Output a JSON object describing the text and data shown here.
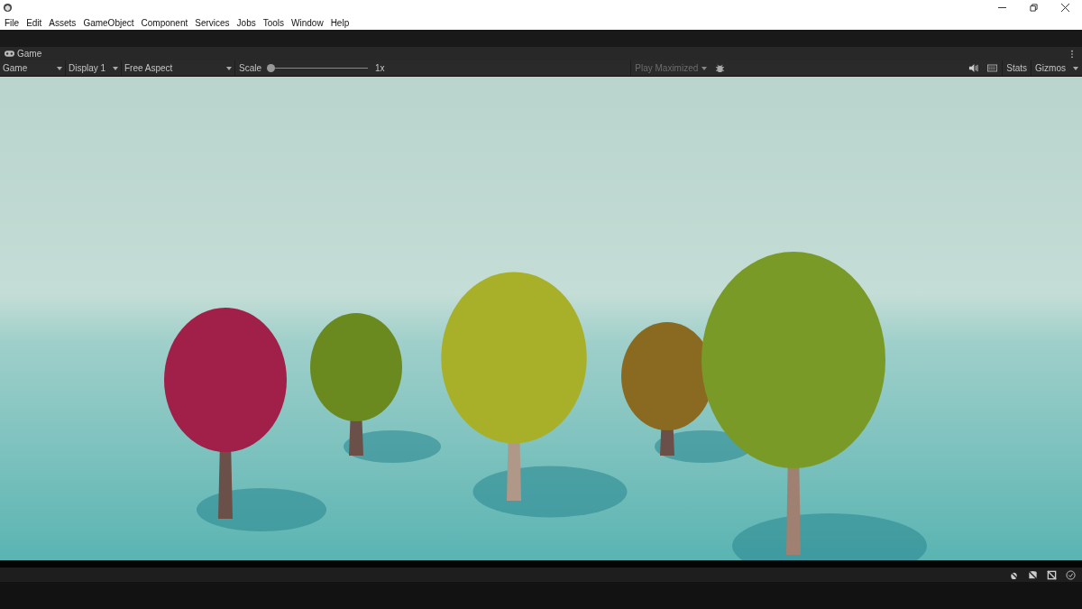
{
  "menu": [
    "File",
    "Edit",
    "Assets",
    "GameObject",
    "Component",
    "Services",
    "Jobs",
    "Tools",
    "Window",
    "Help"
  ],
  "tab": {
    "label": "Game"
  },
  "toolbar": {
    "view": "Game",
    "display": "Display 1",
    "aspect": "Free Aspect",
    "scale_label": "Scale",
    "scale": {
      "level": 0
    },
    "scale_reading": "1x",
    "play_maximized": {
      "label": "Play Maximized",
      "disabled": true
    },
    "stats": {
      "label": "Stats",
      "disabled": false
    },
    "gizmos": {
      "label": "Gizmos",
      "disabled": false
    }
  }
}
